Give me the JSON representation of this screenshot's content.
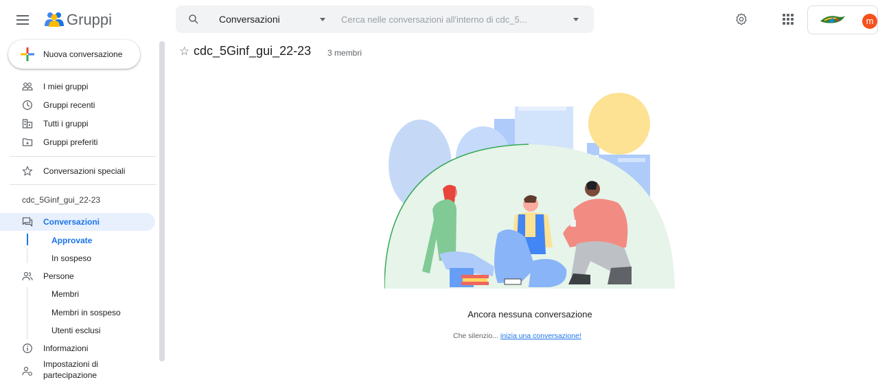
{
  "header": {
    "app_title": "Gruppi",
    "search_scope": "Conversazioni",
    "search_placeholder": "Cerca nelle conversazioni all'interno di cdc_5...",
    "avatar_letter": "m",
    "avatar_color": "#f4511e"
  },
  "sidebar": {
    "new_conversation": "Nuova conversazione",
    "top_items": [
      {
        "label": "I miei gruppi",
        "icon": "people-outline-icon"
      },
      {
        "label": "Gruppi recenti",
        "icon": "clock-icon"
      },
      {
        "label": "Tutti i gruppi",
        "icon": "buildings-icon"
      },
      {
        "label": "Gruppi preferiti",
        "icon": "folder-star-icon"
      }
    ],
    "starred": "Conversazioni speciali",
    "group_name": "cdc_5Ginf_gui_22-23",
    "conversazioni": "Conversazioni",
    "approvate": "Approvate",
    "in_sospeso": "In sospeso",
    "persone": "Persone",
    "membri": "Membri",
    "membri_in_sospeso": "Membri in sospeso",
    "utenti_esclusi": "Utenti esclusi",
    "informazioni": "Informazioni",
    "impostazioni": "Impostazioni di",
    "impostazioni_2": "partecipazione"
  },
  "main": {
    "group_title": "cdc_5Ginf_gui_22-23",
    "members_count": "3 membri",
    "empty_title": "Ancora nessuna conversazione",
    "empty_sub_prefix": "Che silenzio...",
    "empty_sub_link": "inizia una conversazione!"
  },
  "colors": {
    "accent": "#1a73e8",
    "active_bg": "#e8f0fe"
  }
}
